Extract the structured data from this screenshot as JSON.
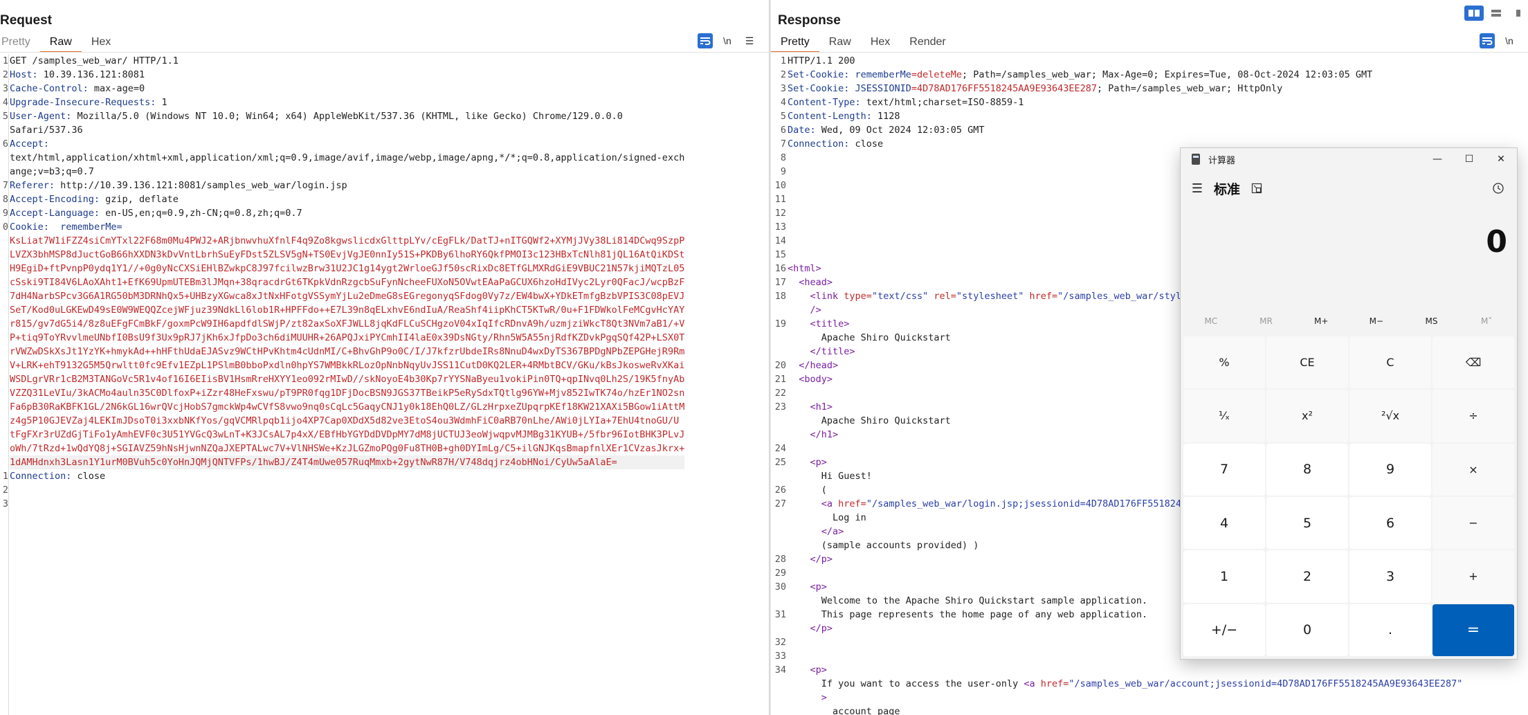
{
  "request": {
    "title": "Request",
    "tabs": [
      "Pretty",
      "Raw",
      "Hex"
    ],
    "active_tab": "Raw",
    "toolbar": {
      "newline_label": "\\n",
      "menu_label": "☰"
    },
    "lines": [
      {
        "n": "1",
        "key": "",
        "val": "GET /samples_web_war/ HTTP/1.1"
      },
      {
        "n": "2",
        "key": "Host:",
        "val": " 10.39.136.121:8081"
      },
      {
        "n": "3",
        "key": "Cache-Control:",
        "val": " max-age=0"
      },
      {
        "n": "4",
        "key": "Upgrade-Insecure-Requests:",
        "val": " 1"
      },
      {
        "n": "5",
        "key": "User-Agent:",
        "val": " Mozilla/5.0 (Windows NT 10.0; Win64; x64) AppleWebKit/537.36 (KHTML, like Gecko) Chrome/129.0.0.0"
      },
      {
        "n": "",
        "key": "",
        "val": "Safari/537.36"
      },
      {
        "n": "6",
        "key": "Accept:",
        "val": ""
      },
      {
        "n": "",
        "key": "",
        "val": "text/html,application/xhtml+xml,application/xml;q=0.9,image/avif,image/webp,image/apng,*/*;q=0.8,application/signed-exch"
      },
      {
        "n": "",
        "key": "",
        "val": "ange;v=b3;q=0.7"
      },
      {
        "n": "7",
        "key": "Referer:",
        "val": " http://10.39.136.121:8081/samples_web_war/login.jsp"
      },
      {
        "n": "8",
        "key": "Accept-Encoding:",
        "val": " gzip, deflate"
      },
      {
        "n": "9",
        "key": "Accept-Language:",
        "val": " en-US,en;q=0.9,zh-CN;q=0.8,zh;q=0.7"
      },
      {
        "n": "0",
        "key": "Cookie:",
        "val": "  ",
        "ck": "rememberMe="
      }
    ],
    "cookie_lines": [
      "KsLiat7W1iFZZ4siCmYTxl22F68m0Mu4PWJ2+ARjbnwvhuXfnlF4q9Zo8kgwslicdxGlttpLYv/cEgFLk/DatTJ+nITGQWf2+XYMjJVy38Li814DCwq9SzpP",
      "LVZX3bhMSP8dJuctGoB66hXXDN3kDvVntLbrhSuEyFDst5ZLSV5gN+TS0EvjVgJE0nnIy51S+PKDBy6lhoRY6QkfPMOI3c123HBxTcNlh81jQL16AtQiKDSt",
      "H9EgiD+ftPvnpP0ydq1Y1//+0g0yNcCXSiEHlBZwkpC8J97fcilwzBrw31U2JC1g14ygt2WrloeGJf50scRixDc8ETfGLMXRdGiE9VBUC21N57kjiMQTzL05",
      "cSski9TI84V6LAoXAht1+EfK69UpmUTEBm3lJMqn+38qracdrGt6TKpkVdnRzgcbSuFynNcheeFUXoN5OVwtEAaPaGCUX6hzoHdIVyc2Lyr0QFacJ/wcpBzF",
      "7dH4NarbSPcv3G6A1RG50bM3DRNhQx5+UHBzyXGwca8xJtNxHFotgVSSymYjLu2eDmeG8sEGregonyqSFdog0Vy7z/EW4bwX+YDkETmfgBzbVPIS3C08pEVJ",
      "SeT/Kod0uLGKEwD49sE0W9WEQQZcejWFjuz39NdkLl6lob1R+HPFFdo++E7L39n8qELxhvE6ndIuA/ReaShf4iipKhCT5KTwR/0u+F1FDWkolFeMCgvHcYAY",
      "r815/gv7dG5i4/8z8uEFgFCmBkF/goxmPcW9IH6apdfdlSWjP/zt82axSoXFJWLL8jqKdFLCuSCHgzoV04xIqIfcRDnvA9h/uzmjziWkcT8Qt3NVm7aB1/+V",
      "P+tiq9ToYRvvlmeUNbfI0BsU9f3Ux9pRJ7jKh6xJfpDo3ch6diMUUHR+26APQJxiPYCmhII4laE0x39DsNGty/Rhn5W5A55njRdfKZDvkPgqSQf42P+LSX0T",
      "rVWZwDSkXsJt1YzYK+hmykAd++hHFthUdaEJASvz9WCtHPvKhtm4cUdnMI/C+BhvGhP9o0C/I/J7kfzrUbdeIRs8NnuD4wxDyTS367BPDgNPbZEPGHejR9Rm",
      "V+LRK+ehT9132G5M5Qrwltt0fc9Efv1EZpL1PSlmB0bboPxdln0hpYS7WMBkkRLozOpNnbNqyUvJSS11CutD0KQ2LER+4RMbtBCV/GKu/kBsJkosweRvXKai",
      "WSDLgrVRr1cB2M3TANGoVc5R1v4of16I6EIisBV1HsmRreHXYY1eo092rMIwD//skNoyoE4b30Kp7rYYSNaByeu1vokiPin0TQ+qpINvq0Lh2S/19K5fnyAb",
      "VZZQ31LeVIu/3kACMo4auln35C0DlfoxP+iZzr48HeFxswu/pT9PR0fqg1DFjDocBSN9JGS37TBeikP5eRySdxTQtlg96YW+Mjv852IwTK74o/hzEr1NO2sn",
      "Fa6pB30RaKBFK1GL/2N6kGL16wrQVcjHobS7gmckWp4wCVfS8vwo9nq0sCqLc5GaqyCNJ1y0k18EhQ0LZ/GLzHrpxeZUpqrpKEf18KW21XAXi5BGow1iAttM",
      "z4g5P10GJEVZaj4LEKImJDsoT0i3xxbNKfYos/gqVCMRlpqb1ijo4XP7Cap0XDdX5d82ve3EtoS4ou3WdmhFiC0aRB70nLhe/AWi0jLYIa+7EhU4tnoGU/U",
      "tFgFXr3rUZdGjTiFo1yAmhEVF0c3U51YVGcQ3wLnT+K3JCsAL7p4xX/EBfHbYGYDdDVDpMY7dM8jUCTUJ3eoWjwqpvMJMBg31KYUB+/5fbr96IotBHK3PLvJ",
      "oWh/7tRzd+1wQdYQ8j+SGIAVZ59hNsHjwnNZQaJXEPTALwc7V+VlNHSWe+KzJLGZmoPQg0Fu8TH0B+gh0DYImLg/C5+ilGNJKqsBmapfnlXEr1CVzasJkrx+",
      "1dAMHdnxh3Lasn1Y1urM0BVuh5c0YoHnJQMjQNTVFPs/1hwBJ/Z4T4mUwe057RuqMmxb+2gytNwR87H/V748dqjrz4obHNoi/CyUw5aAlaE="
    ],
    "tail_lines": [
      {
        "n": "1",
        "key": "Connection:",
        "val": " close"
      },
      {
        "n": "2",
        "key": "",
        "val": ""
      },
      {
        "n": "3",
        "key": "",
        "val": ""
      }
    ]
  },
  "response": {
    "title": "Response",
    "tabs": [
      "Pretty",
      "Raw",
      "Hex",
      "Render"
    ],
    "active_tab": "Pretty",
    "toolbar": {
      "newline_label": "\\n"
    },
    "header_lines": [
      {
        "n": "1",
        "key": "",
        "val": "HTTP/1.1 200"
      },
      {
        "n": "2",
        "key": "Set-Cookie:",
        "val": " ",
        "ck": "rememberMe",
        "cv": "=deleteMe",
        "rest": "; Path=/samples_web_war; Max-Age=0; Expires=Tue, 08-Oct-2024 12:03:05 GMT"
      },
      {
        "n": "3",
        "key": "Set-Cookie:",
        "val": " ",
        "ck": "JSESSIONID",
        "cv": "=4D78AD176FF5518245AA9E93643EE287",
        "rest": "; Path=/samples_web_war; HttpOnly"
      },
      {
        "n": "4",
        "key": "Content-Type:",
        "val": " text/html;charset=ISO-8859-1"
      },
      {
        "n": "5",
        "key": "Content-Length:",
        "val": " 1128"
      },
      {
        "n": "6",
        "key": "Date:",
        "val": " Wed, 09 Oct 2024 12:03:05 GMT"
      },
      {
        "n": "7",
        "key": "Connection:",
        "val": " close"
      },
      {
        "n": "8",
        "key": "",
        "val": ""
      },
      {
        "n": "9",
        "key": "",
        "val": ""
      },
      {
        "n": "10",
        "key": "",
        "val": ""
      },
      {
        "n": "11",
        "key": "",
        "val": ""
      },
      {
        "n": "12",
        "key": "",
        "val": ""
      },
      {
        "n": "13",
        "key": "",
        "val": ""
      },
      {
        "n": "14",
        "key": "",
        "val": ""
      },
      {
        "n": "15",
        "key": "",
        "val": ""
      }
    ],
    "html_lines": [
      {
        "n": "16",
        "ind": "",
        "parts": [
          [
            "tag",
            "<html>"
          ]
        ]
      },
      {
        "n": "17",
        "ind": "  ",
        "parts": [
          [
            "tag",
            "<head>"
          ]
        ]
      },
      {
        "n": "18",
        "ind": "    ",
        "parts": [
          [
            "tag",
            "<link "
          ],
          [
            "attr",
            "type="
          ],
          [
            "attrv",
            "\"text/css\" "
          ],
          [
            "attr",
            "rel="
          ],
          [
            "attrv",
            "\"stylesheet\" "
          ],
          [
            "attr",
            "href="
          ],
          [
            "attrv",
            "\"/samples_web_war/style.css\""
          ]
        ]
      },
      {
        "n": "",
        "ind": "    ",
        "parts": [
          [
            "tag",
            "/>"
          ]
        ]
      },
      {
        "n": "19",
        "ind": "    ",
        "parts": [
          [
            "tag",
            "<title>"
          ]
        ]
      },
      {
        "n": "",
        "ind": "      ",
        "parts": [
          [
            "text",
            "Apache Shiro Quickstart"
          ]
        ]
      },
      {
        "n": "",
        "ind": "    ",
        "parts": [
          [
            "tag",
            "</title>"
          ]
        ]
      },
      {
        "n": "20",
        "ind": "  ",
        "parts": [
          [
            "tag",
            "</head>"
          ]
        ]
      },
      {
        "n": "21",
        "ind": "  ",
        "parts": [
          [
            "tag",
            "<body>"
          ]
        ]
      },
      {
        "n": "22",
        "ind": "",
        "parts": []
      },
      {
        "n": "23",
        "ind": "    ",
        "parts": [
          [
            "tag",
            "<h1>"
          ]
        ]
      },
      {
        "n": "",
        "ind": "      ",
        "parts": [
          [
            "text",
            "Apache Shiro Quickstart"
          ]
        ]
      },
      {
        "n": "",
        "ind": "    ",
        "parts": [
          [
            "tag",
            "</h1>"
          ]
        ]
      },
      {
        "n": "24",
        "ind": "",
        "parts": []
      },
      {
        "n": "25",
        "ind": "    ",
        "parts": [
          [
            "tag",
            "<p>"
          ]
        ]
      },
      {
        "n": "",
        "ind": "      ",
        "parts": [
          [
            "text",
            "Hi Guest!"
          ]
        ]
      },
      {
        "n": "26",
        "ind": "      ",
        "parts": [
          [
            "text",
            "("
          ]
        ]
      },
      {
        "n": "27",
        "ind": "      ",
        "parts": [
          [
            "tag",
            "<a "
          ],
          [
            "attr",
            "href="
          ],
          [
            "attrv",
            "\"/samples_web_war/login.jsp;jsessionid=4D78AD176FF5518245AA9E93643EE287\""
          ],
          [
            "tag",
            ">"
          ]
        ]
      },
      {
        "n": "",
        "ind": "        ",
        "parts": [
          [
            "text",
            "Log in"
          ]
        ]
      },
      {
        "n": "",
        "ind": "      ",
        "parts": [
          [
            "tag",
            "</a>"
          ]
        ]
      },
      {
        "n": "",
        "ind": "      ",
        "parts": [
          [
            "text",
            "(sample accounts provided) )"
          ]
        ]
      },
      {
        "n": "28",
        "ind": "    ",
        "parts": [
          [
            "tag",
            "</p>"
          ]
        ]
      },
      {
        "n": "29",
        "ind": "",
        "parts": []
      },
      {
        "n": "30",
        "ind": "    ",
        "parts": [
          [
            "tag",
            "<p>"
          ]
        ]
      },
      {
        "n": "",
        "ind": "      ",
        "parts": [
          [
            "text",
            "Welcome to the Apache Shiro Quickstart sample application."
          ]
        ]
      },
      {
        "n": "31",
        "ind": "      ",
        "parts": [
          [
            "text",
            "This page represents the home page of any web application."
          ]
        ]
      },
      {
        "n": "",
        "ind": "    ",
        "parts": [
          [
            "tag",
            "</p>"
          ]
        ]
      },
      {
        "n": "32",
        "ind": "",
        "parts": []
      },
      {
        "n": "33",
        "ind": "",
        "parts": []
      },
      {
        "n": "34",
        "ind": "    ",
        "parts": [
          [
            "tag",
            "<p>"
          ]
        ]
      },
      {
        "n": "",
        "ind": "      ",
        "parts": [
          [
            "text",
            "If you want to access the user-only "
          ],
          [
            "tag",
            "<a "
          ],
          [
            "attr",
            "href="
          ],
          [
            "attrv",
            "\"/samples_web_war/account;jsessionid=4D78AD176FF5518245AA9E93643EE287\""
          ]
        ]
      },
      {
        "n": "",
        "ind": "      ",
        "parts": [
          [
            "tag",
            ">"
          ]
        ]
      },
      {
        "n": "",
        "ind": "        ",
        "parts": [
          [
            "text",
            "account page"
          ]
        ]
      }
    ]
  },
  "calculator": {
    "title": "计算器",
    "mode": "标准",
    "display": "0",
    "window_buttons": [
      "—",
      "☐",
      "✕"
    ],
    "memory": [
      {
        "label": "MC",
        "enabled": false
      },
      {
        "label": "MR",
        "enabled": false
      },
      {
        "label": "M+",
        "enabled": true
      },
      {
        "label": "M−",
        "enabled": true
      },
      {
        "label": "MS",
        "enabled": true
      },
      {
        "label": "M˅",
        "enabled": false
      }
    ],
    "keys": [
      {
        "label": "%",
        "kind": "fn",
        "name": "percent-key"
      },
      {
        "label": "CE",
        "kind": "fn",
        "name": "clear-entry-key"
      },
      {
        "label": "C",
        "kind": "fn",
        "name": "clear-key"
      },
      {
        "label": "⌫",
        "kind": "fn",
        "name": "backspace-key"
      },
      {
        "label": "¹⁄ₓ",
        "kind": "fn",
        "name": "reciprocal-key"
      },
      {
        "label": "x²",
        "kind": "fn",
        "name": "square-key"
      },
      {
        "label": "²√x",
        "kind": "fn",
        "name": "sqrt-key"
      },
      {
        "label": "÷",
        "kind": "fn",
        "name": "divide-key"
      },
      {
        "label": "7",
        "kind": "num",
        "name": "digit-7-key"
      },
      {
        "label": "8",
        "kind": "num",
        "name": "digit-8-key"
      },
      {
        "label": "9",
        "kind": "num",
        "name": "digit-9-key"
      },
      {
        "label": "×",
        "kind": "fn",
        "name": "multiply-key"
      },
      {
        "label": "4",
        "kind": "num",
        "name": "digit-4-key"
      },
      {
        "label": "5",
        "kind": "num",
        "name": "digit-5-key"
      },
      {
        "label": "6",
        "kind": "num",
        "name": "digit-6-key"
      },
      {
        "label": "−",
        "kind": "fn",
        "name": "minus-key"
      },
      {
        "label": "1",
        "kind": "num",
        "name": "digit-1-key"
      },
      {
        "label": "2",
        "kind": "num",
        "name": "digit-2-key"
      },
      {
        "label": "3",
        "kind": "num",
        "name": "digit-3-key"
      },
      {
        "label": "+",
        "kind": "fn",
        "name": "plus-key"
      },
      {
        "label": "+/−",
        "kind": "num",
        "name": "negate-key"
      },
      {
        "label": "0",
        "kind": "num",
        "name": "digit-0-key"
      },
      {
        "label": ".",
        "kind": "num",
        "name": "decimal-key"
      },
      {
        "label": "=",
        "kind": "eq",
        "name": "equals-key"
      }
    ]
  },
  "colors": {
    "accent": "#e26a2c",
    "header_key": "#1d3c8f",
    "cookie": "#c0292b",
    "tag": "#7b1fa2",
    "calc_equals": "#005fb8"
  }
}
